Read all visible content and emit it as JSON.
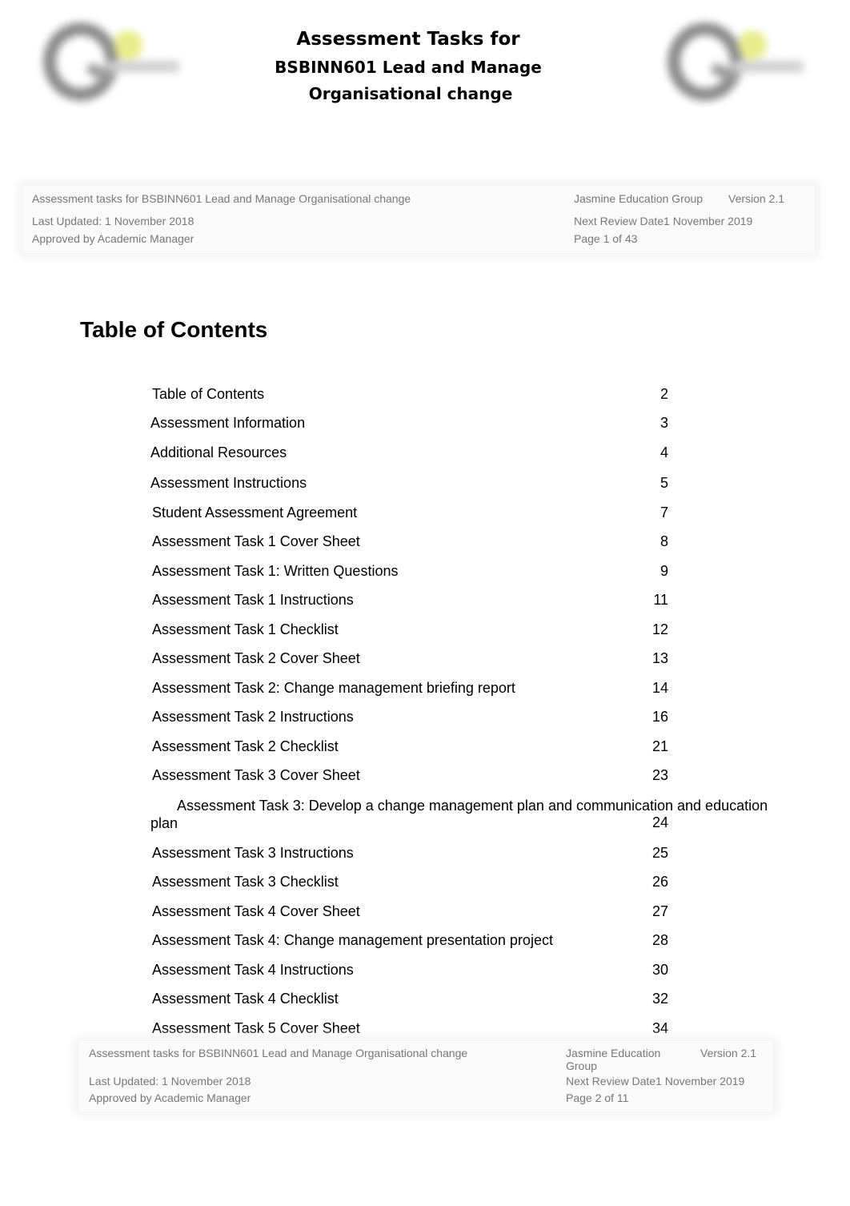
{
  "header": {
    "title_line1": "Assessment Tasks for",
    "title_line2": "BSBINN601 Lead and Manage",
    "title_line3": "Organisational change",
    "logo_left": "organisation-logo",
    "logo_right": "organisation-logo"
  },
  "footer_page1": {
    "doc_title": "Assessment tasks for BSBINN601 Lead and Manage Organisational change",
    "organisation": "Jasmine Education Group",
    "version": "Version 2.1",
    "last_updated": "Last Updated: 1 November 2018",
    "next_review": "Next Review Date1 November 2019",
    "approved": "Approved  by Academic Manager",
    "page": "Page 1 of 43"
  },
  "toc": {
    "heading": "Table of Contents",
    "entries": [
      {
        "label": "Table of Contents",
        "page": "2"
      },
      {
        "label": "Assessment Information",
        "page": "3"
      },
      {
        "label": "Additional Resources",
        "page": "4"
      },
      {
        "label": "Assessment Instructions",
        "page": "5"
      },
      {
        "label": "Student Assessment Agreement",
        "page": "7"
      },
      {
        "label": "Assessment Task 1 Cover Sheet",
        "page": "8"
      },
      {
        "label": "Assessment Task 1: Written Questions",
        "page": "9"
      },
      {
        "label": "Assessment Task 1 Instructions",
        "page": "11"
      },
      {
        "label": "Assessment Task 1 Checklist",
        "page": "12"
      },
      {
        "label": "Assessment Task 2 Cover Sheet",
        "page": "13"
      },
      {
        "label": "Assessment Task 2: Change management briefing report",
        "page": "14"
      },
      {
        "label": "Assessment Task 2 Instructions",
        "page": "16"
      },
      {
        "label": "Assessment Task 2 Checklist",
        "page": "21"
      },
      {
        "label": "Assessment Task 3 Cover Sheet",
        "page": "23"
      },
      {
        "label_line1": "Assessment Task 3: Develop a change management plan and communication and education",
        "label_line2": "plan",
        "page": "24"
      },
      {
        "label": "Assessment Task 3 Instructions",
        "page": "25"
      },
      {
        "label": "Assessment Task 3 Checklist",
        "page": "26"
      },
      {
        "label": "Assessment Task 4 Cover Sheet",
        "page": "27"
      },
      {
        "label": "Assessment Task 4: Change management presentation project",
        "page": "28"
      },
      {
        "label": "Assessment Task 4 Instructions",
        "page": "30"
      },
      {
        "label": "Assessment Task 4 Checklist",
        "page": "32"
      },
      {
        "label": "Assessment Task 5 Cover Sheet",
        "page": "34"
      }
    ]
  },
  "footer_page2": {
    "doc_title": "Assessment tasks for BSBINN601 Lead and Manage Organisational change",
    "organisation_line1": "Jasmine Education",
    "organisation_line2": "Group",
    "version": "Version 2.1",
    "last_updated": "Last Updated: 1 November 2018",
    "next_review": "Next Review Date1 November 2019",
    "approved": "Approved  by Academic Manager",
    "page": "Page 2 of 11"
  }
}
